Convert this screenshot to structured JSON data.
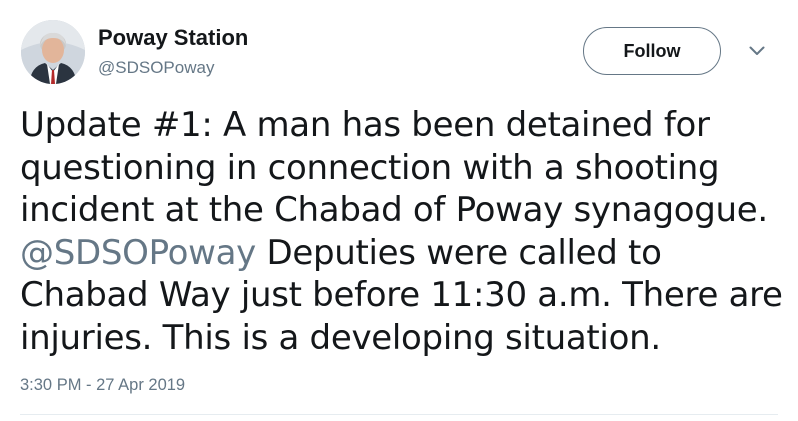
{
  "author": {
    "display_name": "Poway Station",
    "handle": "@SDSOPoway"
  },
  "actions": {
    "follow_label": "Follow",
    "more_icon": "chevron-down-icon"
  },
  "tweet": {
    "line1": "Update #1:  A man has been detained for",
    "line2": "questioning in connection with a shooting",
    "line3": "incident at the Chabad of Poway synagogue.",
    "line4_mention": "@SDSOPoway",
    "line4_rest": " Deputies were called to",
    "line5": "Chabad Way just before 11:30 a.m. There are",
    "line6": "injuries. This is a developing situation.",
    "timestamp": "3:30 PM - 27 Apr 2019"
  },
  "colors": {
    "text": "#14171a",
    "secondary": "#657786",
    "divider": "#e6ecf0"
  }
}
